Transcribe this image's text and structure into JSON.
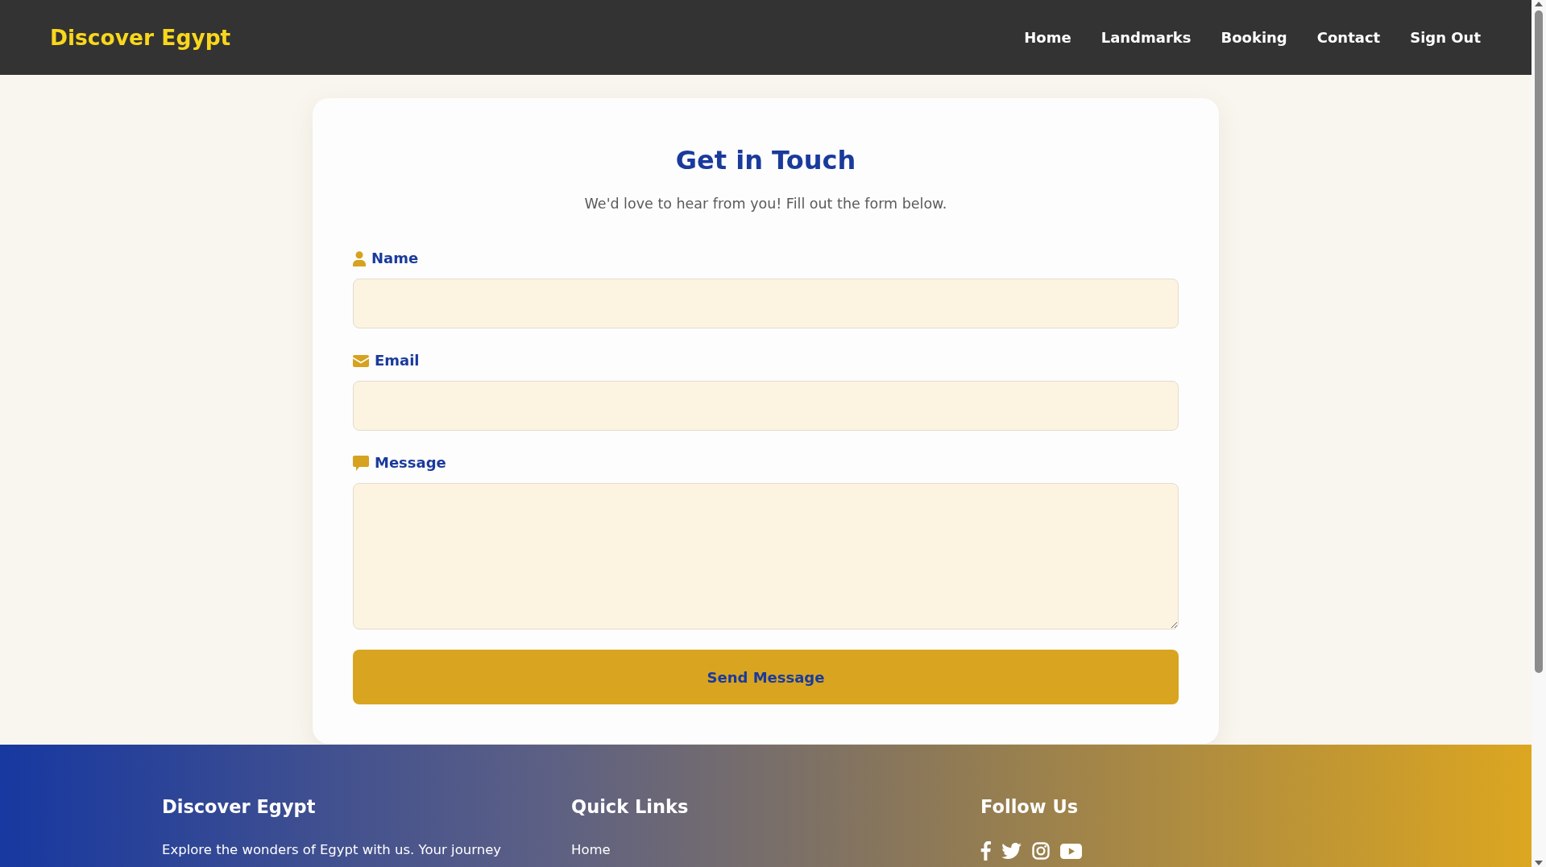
{
  "header": {
    "logo": "Discover Egypt",
    "nav": [
      "Home",
      "Landmarks",
      "Booking",
      "Contact",
      "Sign Out"
    ]
  },
  "contact_form": {
    "title": "Get in Touch",
    "subtitle": "We'd love to hear from you! Fill out the form below.",
    "fields": [
      {
        "kind": "input",
        "label": "Name"
      },
      {
        "kind": "input",
        "label": "Email"
      },
      {
        "kind": "textarea",
        "label": "Message"
      }
    ],
    "submit": "Send Message"
  },
  "footer": {
    "about": {
      "heading": "Discover Egypt",
      "text": "Explore the wonders of Egypt with us. Your journey"
    },
    "quick_links": {
      "heading": "Quick Links",
      "links": [
        "Home"
      ]
    },
    "follow": {
      "heading": "Follow Us"
    }
  }
}
